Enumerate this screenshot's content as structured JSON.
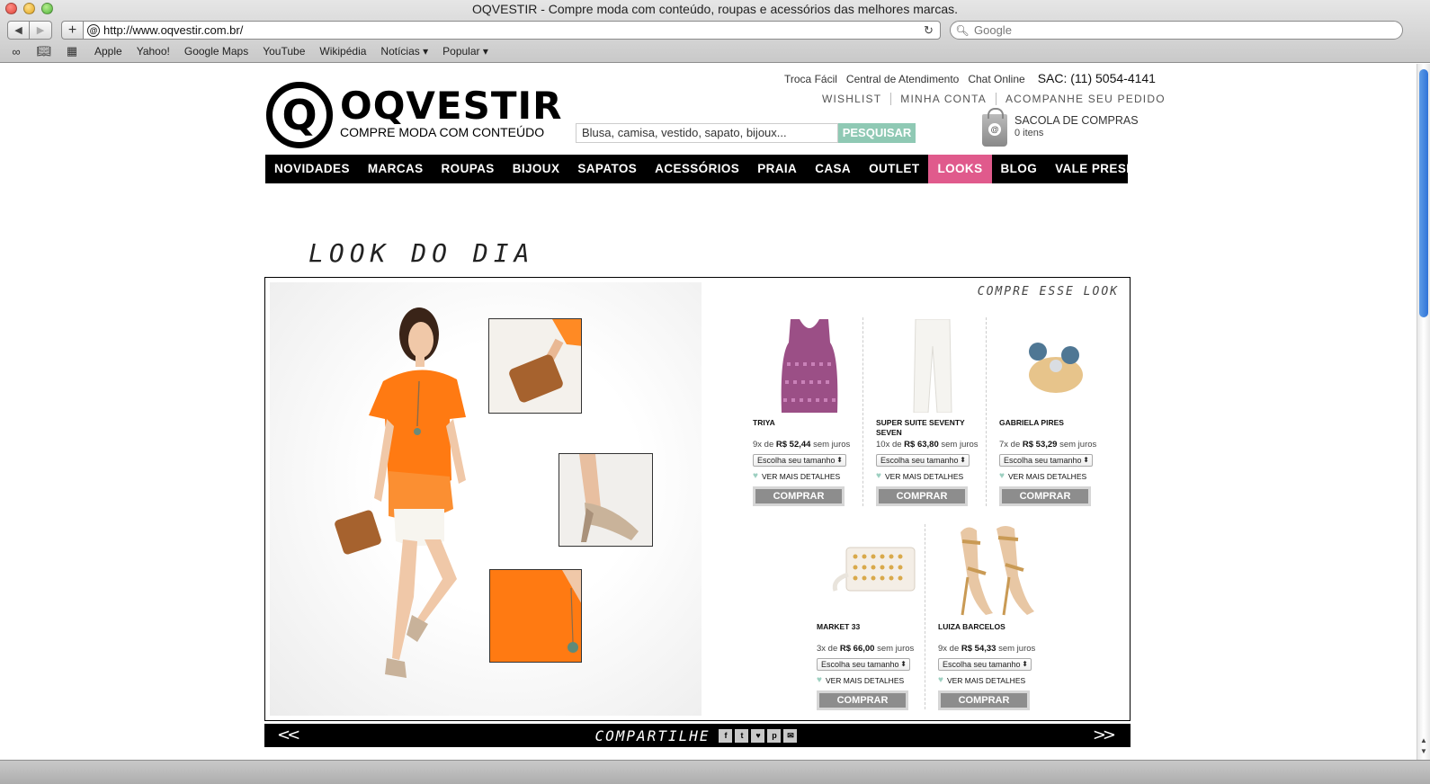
{
  "browser": {
    "window_title": "OQVESTIR - Compre moda com conteúdo, roupas e acessórios das melhores marcas.",
    "url": "http://www.oqvestir.com.br/",
    "search_placeholder": "Google",
    "bookmarks": [
      "Apple",
      "Yahoo!",
      "Google Maps",
      "YouTube",
      "Wikipédia",
      "Notícias ▾",
      "Popular ▾"
    ]
  },
  "header": {
    "top_links": [
      "Troca Fácil",
      "Central de Atendimento",
      "Chat Online"
    ],
    "sac": "SAC: (11) 5054-4141",
    "account_links": [
      "WISHLIST",
      "MINHA CONTA",
      "ACOMPANHE SEU PEDIDO"
    ],
    "logo_word": "OQVESTIR",
    "logo_mark": "Q",
    "tagline": "COMPRE MODA COM CONTEÚDO",
    "search_value": "Blusa, camisa, vestido, sapato, bijoux...",
    "search_button": "PESQUISAR",
    "bag_label": "SACOLA DE COMPRAS",
    "bag_count": "0 itens",
    "bag_mark": "@"
  },
  "nav": [
    "NOVIDADES",
    "MARCAS",
    "ROUPAS",
    "BIJOUX",
    "SAPATOS",
    "ACESSÓRIOS",
    "PRAIA",
    "CASA",
    "OUTLET",
    "LOOKS",
    "BLOG",
    "VALE PRESENTE"
  ],
  "nav_active": "LOOKS",
  "look": {
    "title": "LOOK DO DIA",
    "shop_label": "COMPRE ESSE LOOK",
    "share_label": "COMPARTILHE",
    "share_icons": [
      "f",
      "t",
      "♥",
      "p",
      "✉"
    ],
    "products": [
      {
        "brand": "TRIYA",
        "installments": "9x de",
        "price": "R$ 52,44",
        "suffix": "sem juros",
        "size_label": "Escolha seu tamanho",
        "details": "VER MAIS DETALHES",
        "buy": "COMPRAR"
      },
      {
        "brand": "SUPER SUITE SEVENTY SEVEN",
        "installments": "10x de",
        "price": "R$ 63,80",
        "suffix": "sem juros",
        "size_label": "Escolha seu tamanho",
        "details": "VER MAIS DETALHES",
        "buy": "COMPRAR"
      },
      {
        "brand": "GABRIELA PIRES",
        "installments": "7x de",
        "price": "R$ 53,29",
        "suffix": "sem juros",
        "size_label": "Escolha seu tamanho",
        "details": "VER MAIS DETALHES",
        "buy": "COMPRAR"
      },
      {
        "brand": "MARKET 33",
        "installments": "3x de",
        "price": "R$ 66,00",
        "suffix": "sem juros",
        "size_label": "Escolha seu tamanho",
        "details": "VER MAIS DETALHES",
        "buy": "COMPRAR"
      },
      {
        "brand": "LUIZA BARCELOS",
        "installments": "9x de",
        "price": "R$ 54,33",
        "suffix": "sem juros",
        "size_label": "Escolha seu tamanho",
        "details": "VER MAIS DETALHES",
        "buy": "COMPRAR"
      }
    ]
  },
  "colors": {
    "accent_pink": "#e05a8c",
    "search_green": "#8fc9b4",
    "nav_bg": "#000000",
    "orange": "#ff7a12"
  }
}
